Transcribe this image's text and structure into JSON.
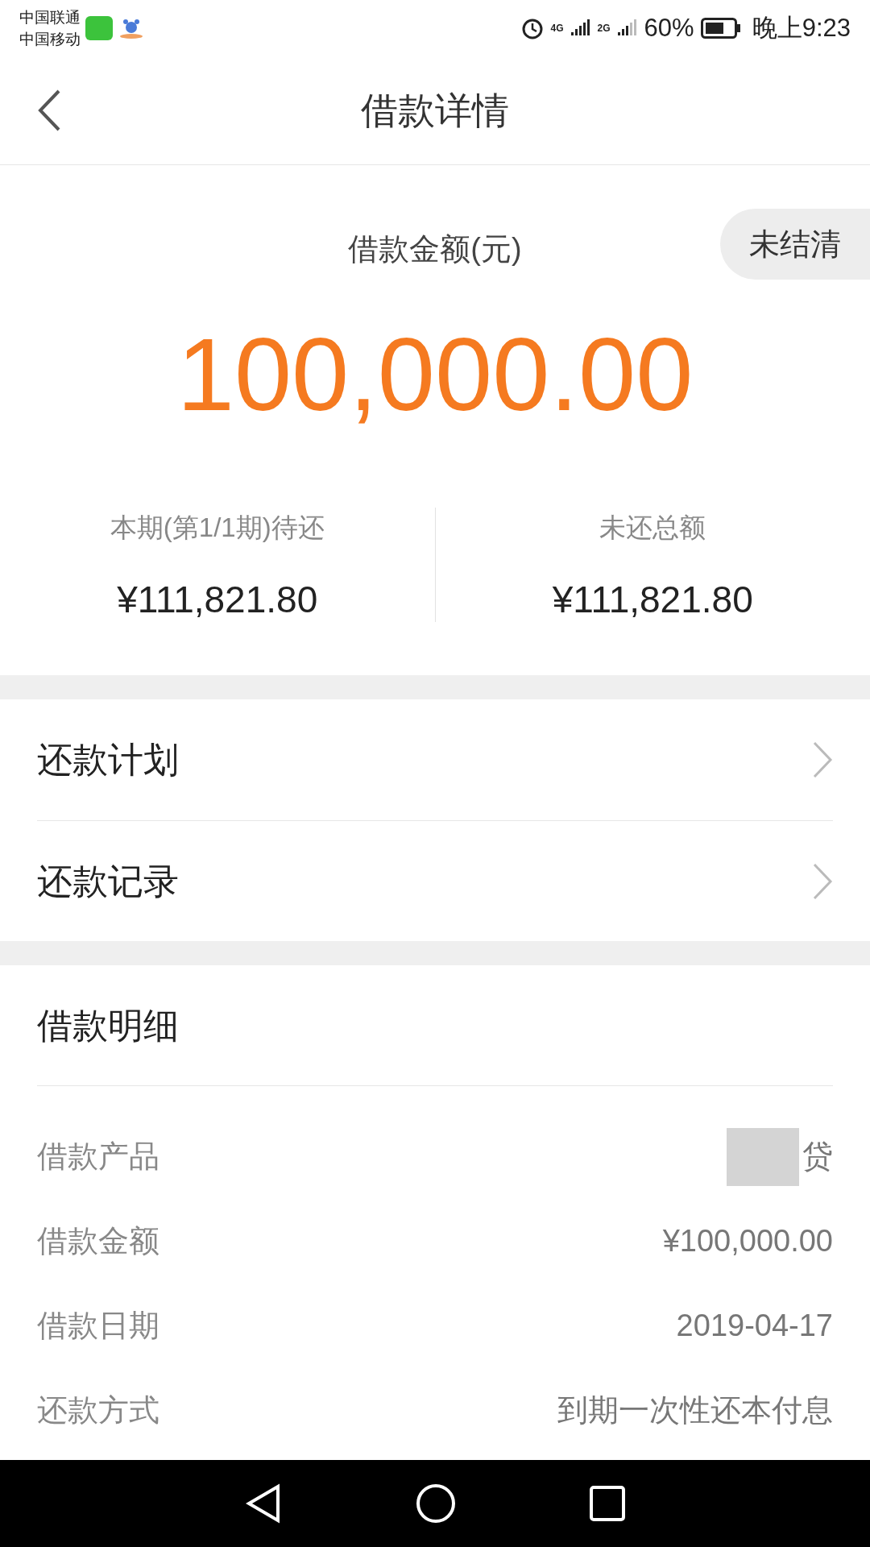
{
  "status_bar": {
    "carriers": [
      "中国联通",
      "中国移动"
    ],
    "network_1": "4G",
    "network_2": "2G",
    "battery": "60%",
    "time": "晚上9:23"
  },
  "header": {
    "title": "借款详情"
  },
  "summary": {
    "label": "借款金额(元)",
    "status": "未结清",
    "amount": "100,000.00",
    "stats": [
      {
        "label": "本期(第1/1期)待还",
        "value": "¥111,821.80"
      },
      {
        "label": "未还总额",
        "value": "¥111,821.80"
      }
    ]
  },
  "links": [
    {
      "label": "还款计划"
    },
    {
      "label": "还款记录"
    }
  ],
  "details": {
    "title": "借款明细",
    "rows": [
      {
        "label": "借款产品",
        "value": "贷",
        "redacted": true
      },
      {
        "label": "借款金额",
        "value": "¥100,000.00",
        "redacted": false
      },
      {
        "label": "借款日期",
        "value": "2019-04-17",
        "redacted": false
      },
      {
        "label": "还款方式",
        "value": "到期一次性还本付息",
        "redacted": false
      }
    ]
  }
}
